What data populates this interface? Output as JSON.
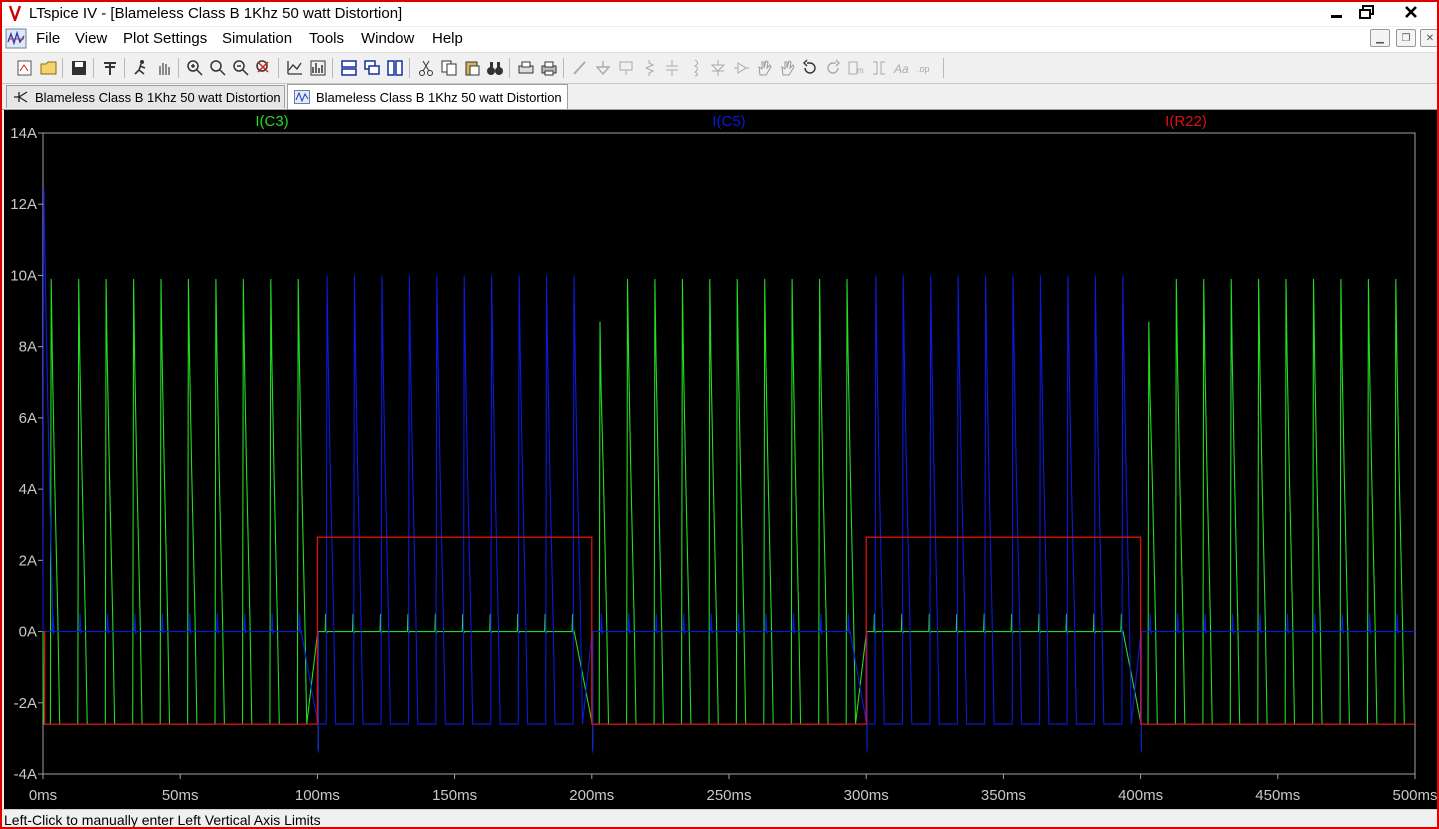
{
  "window": {
    "title": "LTspice IV - [Blameless Class B 1Khz 50 watt Distortion]",
    "controls": [
      "minimize-icon",
      "restore-icon",
      "close-icon"
    ]
  },
  "menu": {
    "items": [
      {
        "label": "File"
      },
      {
        "label": "View"
      },
      {
        "label": "Plot Settings"
      },
      {
        "label": "Simulation"
      },
      {
        "label": "Tools"
      },
      {
        "label": "Window"
      },
      {
        "label": "Help"
      }
    ]
  },
  "toolbar": {
    "icons": [
      "new-schematic-icon",
      "open-icon",
      "save-icon",
      "control-panel-icon",
      "run-icon",
      "halt-icon",
      "zoom-in-icon",
      "zoom-area-icon",
      "zoom-out-icon",
      "zoom-cancel-icon",
      "autorange-icon",
      "view-fft-icon",
      "tile-horizontal-icon",
      "cascade-icon",
      "tile-vertical-icon",
      "cut-icon",
      "copy-icon",
      "paste-icon",
      "find-icon",
      "print-setup-icon",
      "print-icon",
      "draw-wire-icon",
      "ground-icon",
      "label-net-icon",
      "resistor-icon",
      "capacitor-icon",
      "inductor-icon",
      "diode-icon",
      "component-icon",
      "move-icon",
      "drag-icon",
      "undo-icon",
      "redo-icon",
      "rotate-icon",
      "mirror-icon",
      "text-icon",
      "spice-directive-icon"
    ]
  },
  "tabs": [
    {
      "label": "Blameless Class B 1Khz 50 watt Distortion",
      "active": false,
      "icon": "schematic-icon"
    },
    {
      "label": "Blameless Class B 1Khz 50 watt Distortion",
      "active": true,
      "icon": "waveform-icon"
    }
  ],
  "status": {
    "text": "Left-Click to manually enter Left Vertical Axis Limits"
  },
  "colors": {
    "background": "#000000",
    "axis": "#a0a0a0",
    "tick_label": "#c8c8c8",
    "IC3": "#22dd22",
    "IC5": "#0a1adc",
    "IR22": "#e01010",
    "window_border": "#e00000"
  },
  "chart_data": {
    "type": "line",
    "xlabel": "",
    "ylabel": "",
    "xlim": [
      0,
      500
    ],
    "ylim": [
      -4,
      14
    ],
    "x_unit": "ms",
    "y_unit": "A",
    "x_ticks": [
      "0ms",
      "50ms",
      "100ms",
      "150ms",
      "200ms",
      "250ms",
      "300ms",
      "350ms",
      "400ms",
      "450ms",
      "500ms"
    ],
    "y_ticks": [
      "14A",
      "12A",
      "10A",
      "8A",
      "6A",
      "4A",
      "2A",
      "0A",
      "-2A",
      "-4A"
    ],
    "grid": false,
    "legend_placement": "top",
    "pulse_period_ms": 10,
    "series": [
      {
        "name": "I(C3)",
        "color": "#22dd22",
        "description_values": {
          "pulse_peak_A": 9.9,
          "active_low_A": -2.6,
          "idle_A": 0.0,
          "idle_spike_A": 0.5
        },
        "active_intervals_ms": [
          [
            0,
            100
          ],
          [
            200,
            300
          ],
          [
            400,
            500
          ]
        ],
        "first_transition_peaks_A": {
          "100": 8.6,
          "200": 8.7,
          "300": 8.6,
          "400": 8.7
        },
        "transient_A": -3.3
      },
      {
        "name": "I(C5)",
        "color": "#0a1adc",
        "description_values": {
          "pulse_peak_A": 10.0,
          "active_low_A": -2.6,
          "idle_A": 0.0,
          "idle_spike_A": 0.5
        },
        "active_intervals_ms": [
          [
            100,
            200
          ],
          [
            300,
            400
          ]
        ],
        "startup_peak_A": 12.5,
        "transient_A": -3.4
      },
      {
        "name": "I(R22)",
        "color": "#e01010",
        "points": [
          [
            0,
            0
          ],
          [
            0.6,
            0
          ],
          [
            0.6,
            -2.6
          ],
          [
            100,
            -2.6
          ],
          [
            100,
            2.65
          ],
          [
            200,
            2.65
          ],
          [
            200,
            -2.6
          ],
          [
            300,
            -2.6
          ],
          [
            300,
            2.65
          ],
          [
            400,
            2.65
          ],
          [
            400,
            -2.6
          ],
          [
            500,
            -2.6
          ]
        ]
      }
    ]
  }
}
